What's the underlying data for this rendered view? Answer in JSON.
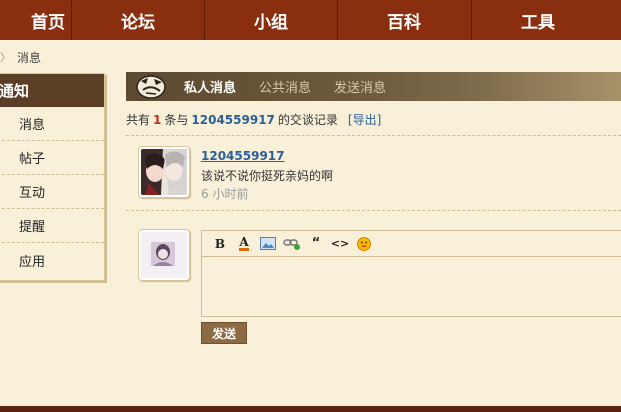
{
  "nav": {
    "items": [
      {
        "label": "首页"
      },
      {
        "label": "论坛"
      },
      {
        "label": "小组"
      },
      {
        "label": "百科"
      },
      {
        "label": "工具"
      }
    ]
  },
  "breadcrumb": {
    "current": "消息"
  },
  "sidebar": {
    "title": "通知",
    "items": [
      {
        "label": "消息"
      },
      {
        "label": "帖子"
      },
      {
        "label": "互动"
      },
      {
        "label": "提醒"
      },
      {
        "label": "应用"
      }
    ]
  },
  "tabs": [
    {
      "label": "私人消息",
      "active": true
    },
    {
      "label": "公共消息",
      "active": false
    },
    {
      "label": "发送消息",
      "active": false
    }
  ],
  "summary": {
    "prefix": "共有",
    "count": "1",
    "mid": "条与",
    "user": "1204559917",
    "suffix": "的交谈记录",
    "export_label": "[导出]"
  },
  "message": {
    "author": "1204559917",
    "text": "该说不说你挺死亲妈的啊",
    "time": "6 小时前"
  },
  "editor": {
    "toolbar": {
      "bold": "B",
      "font_color": "A",
      "quote": "“",
      "code": "<>"
    },
    "send_label": "发送"
  },
  "colors": {
    "nav_bg": "#8a2e10",
    "page_bg": "#f8f0d9",
    "link": "#2c5f96",
    "count": "#d0291c",
    "tabbar": "#5b4a30",
    "button": "#8b6a44"
  }
}
